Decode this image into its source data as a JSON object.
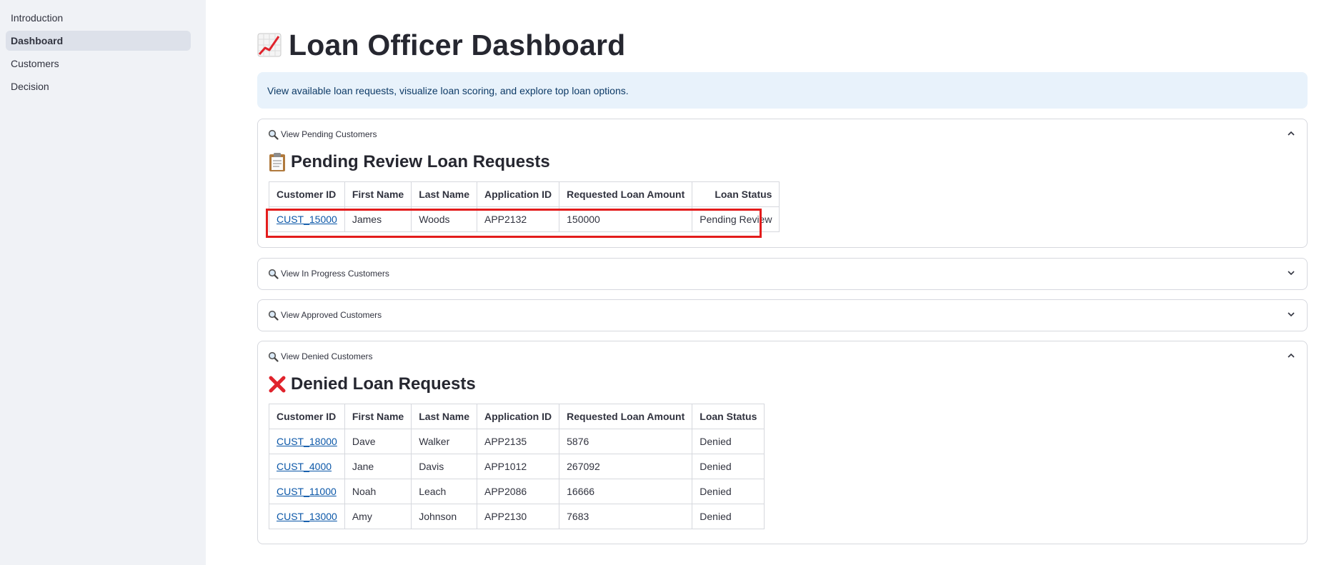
{
  "sidebar": {
    "items": [
      {
        "label": "Introduction"
      },
      {
        "label": "Dashboard"
      },
      {
        "label": "Customers"
      },
      {
        "label": "Decision"
      }
    ]
  },
  "page": {
    "title": "Loan Officer Dashboard",
    "info": "View available loan requests, visualize loan scoring, and explore top loan options."
  },
  "expanders": {
    "pending": {
      "label": "View Pending Customers",
      "section_title": "Pending Review Loan Requests",
      "columns": [
        "Customer ID",
        "First Name",
        "Last Name",
        "Application ID",
        "Requested Loan Amount",
        "Loan Status"
      ],
      "rows": [
        [
          "CUST_15000",
          "James",
          "Woods",
          "APP2132",
          "150000",
          "Pending Review"
        ]
      ]
    },
    "in_progress": {
      "label": "View In Progress Customers"
    },
    "approved": {
      "label": "View Approved Customers"
    },
    "denied": {
      "label": "View Denied Customers",
      "section_title": "Denied Loan Requests",
      "columns": [
        "Customer ID",
        "First Name",
        "Last Name",
        "Application ID",
        "Requested Loan Amount",
        "Loan Status"
      ],
      "rows": [
        [
          "CUST_18000",
          "Dave",
          "Walker",
          "APP2135",
          "5876",
          "Denied"
        ],
        [
          "CUST_4000",
          "Jane",
          "Davis",
          "APP1012",
          "267092",
          "Denied"
        ],
        [
          "CUST_11000",
          "Noah",
          "Leach",
          "APP2086",
          "16666",
          "Denied"
        ],
        [
          "CUST_13000",
          "Amy",
          "Johnson",
          "APP2130",
          "7683",
          "Denied"
        ]
      ]
    }
  },
  "colors": {
    "sidebar_bg": "#f0f2f6",
    "info_bg": "#e8f2fb",
    "link": "#0b57a8",
    "highlight": "#e31c1c"
  }
}
